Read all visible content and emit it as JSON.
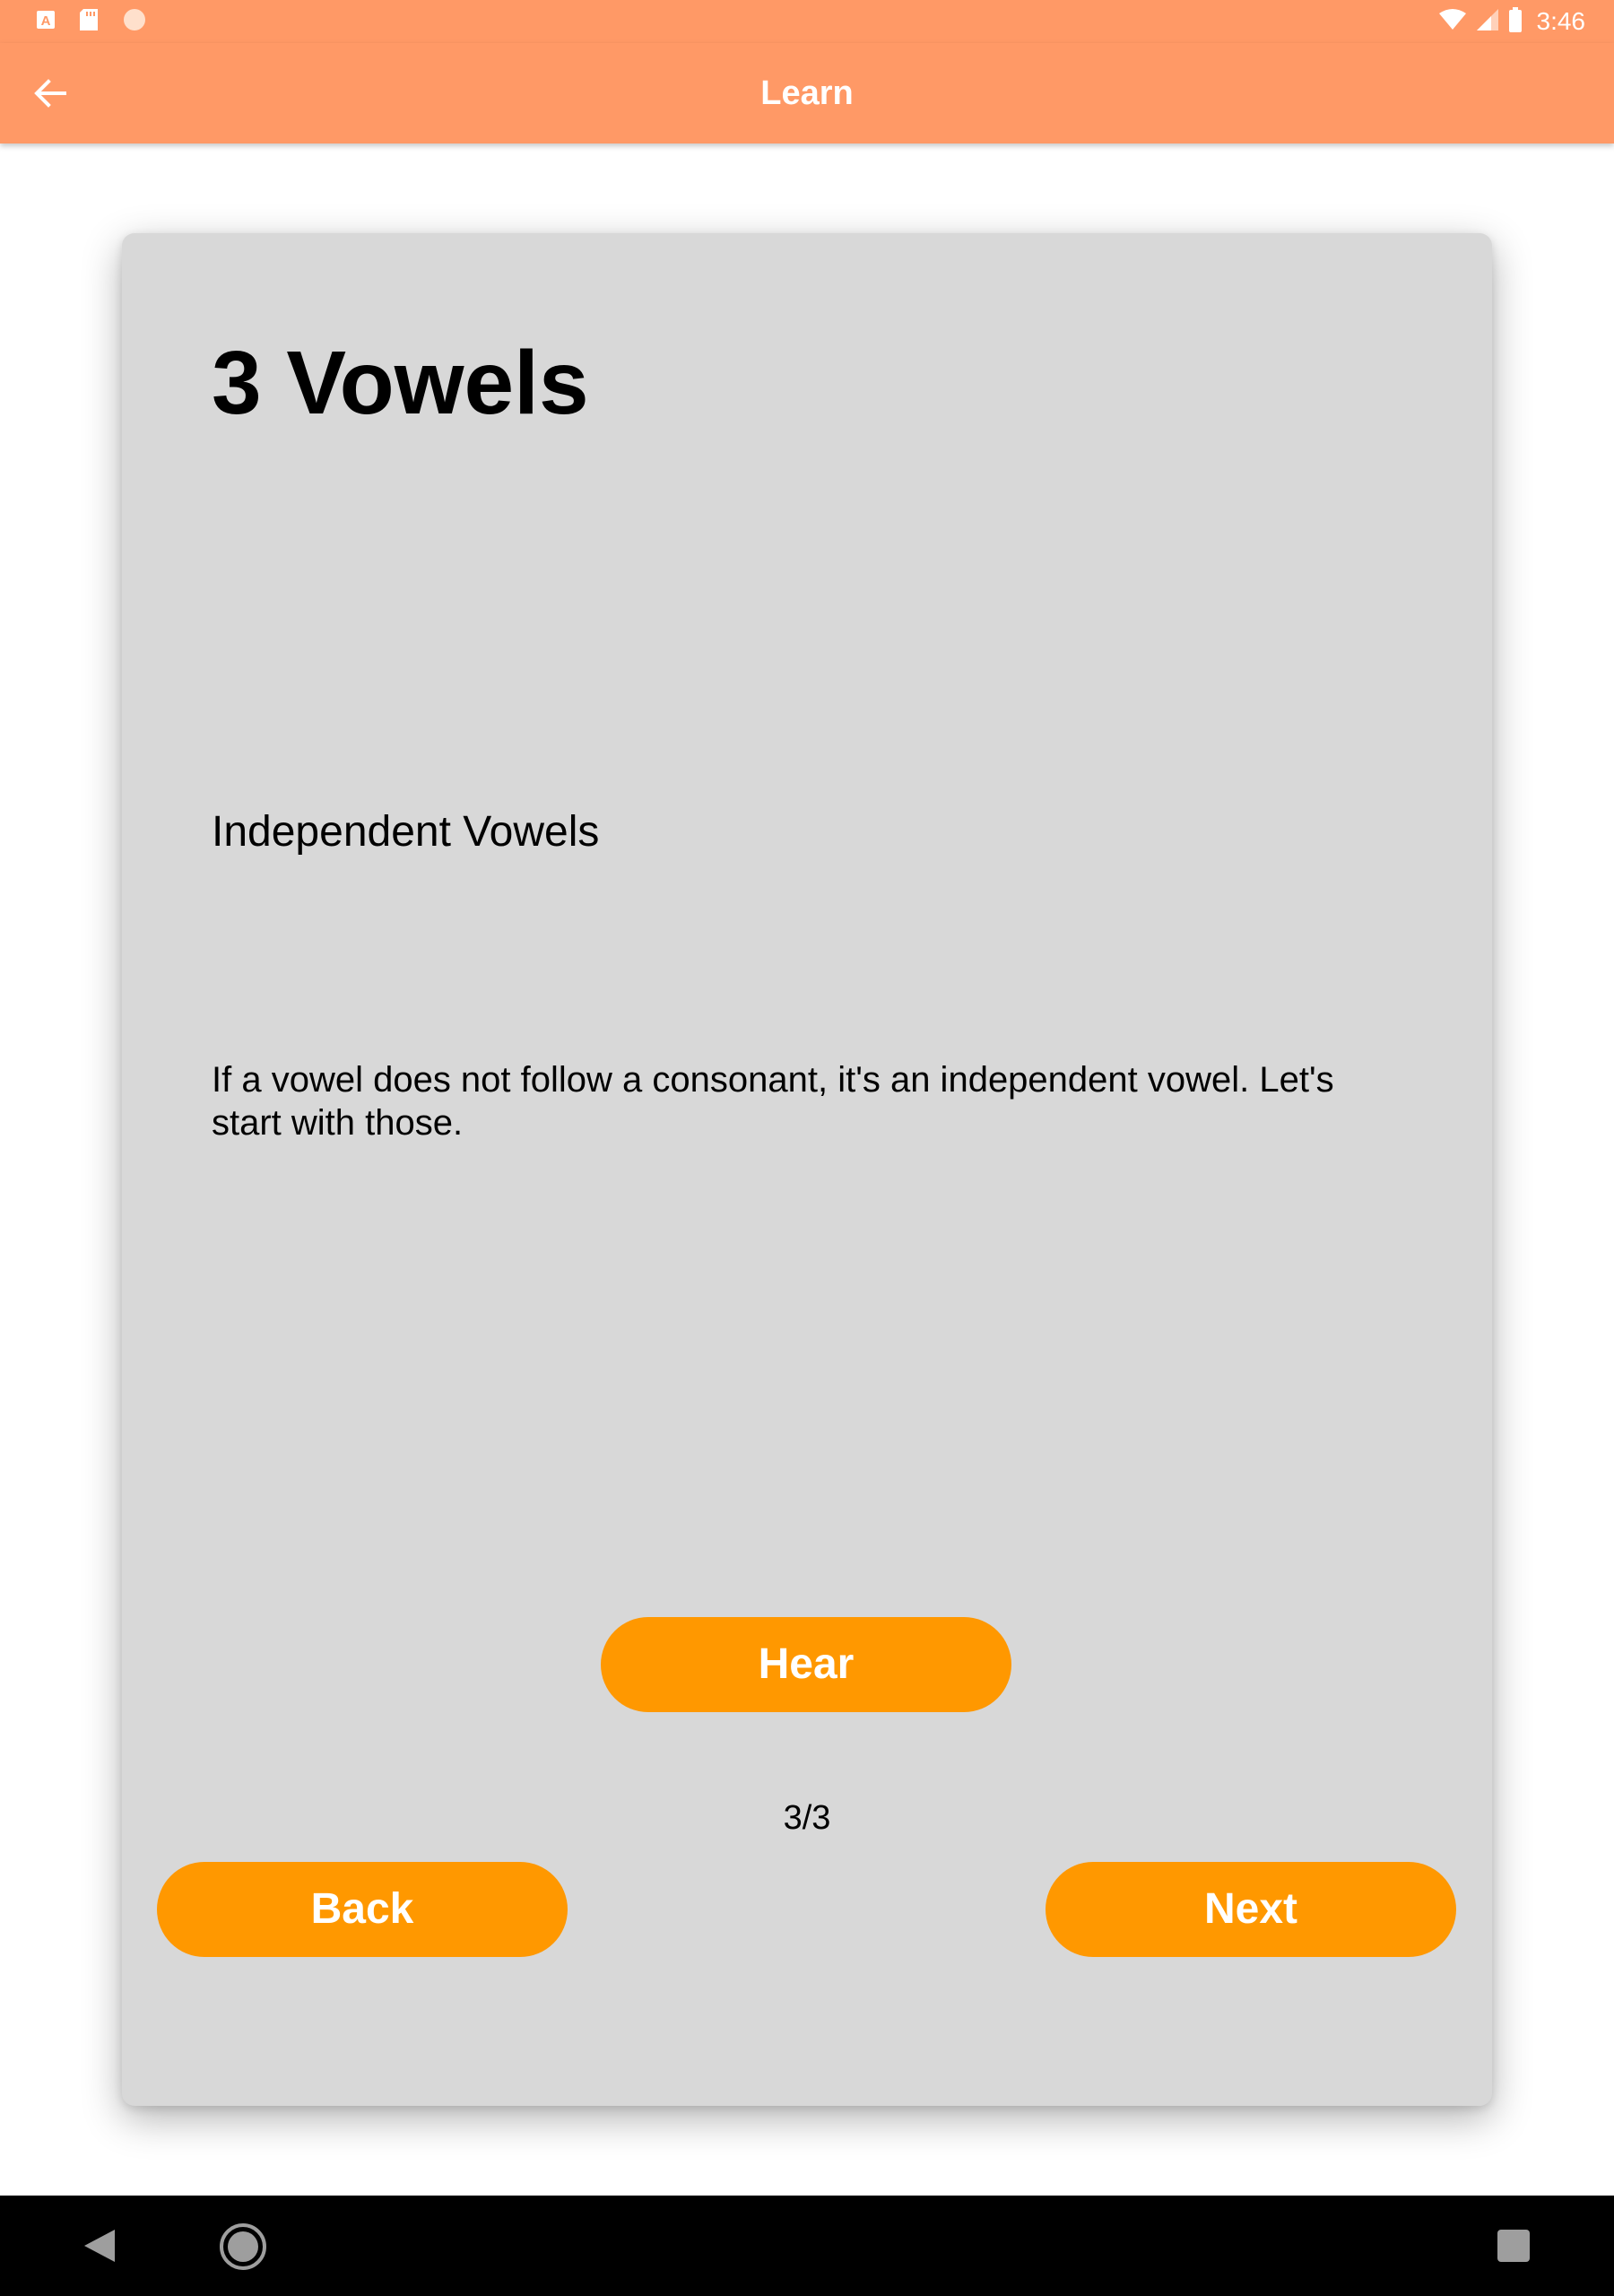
{
  "status_bar": {
    "time": "3:46",
    "left_icons": [
      "app-a-icon",
      "sd-card-icon",
      "circle-icon"
    ],
    "right_icons": [
      "wifi-icon",
      "cell-signal-icon",
      "battery-icon"
    ]
  },
  "app_bar": {
    "title": "Learn",
    "back_icon": "arrow-back-icon"
  },
  "lesson": {
    "title": "3 Vowels",
    "subtitle": "Independent Vowels",
    "body": "If a vowel does not follow a consonant, it's an independent vowel. Let's start with those.",
    "hear_label": "Hear",
    "page_indicator": "3/3",
    "back_label": "Back",
    "next_label": "Next"
  },
  "nav_bar": {
    "icons": [
      "nav-back-icon",
      "nav-home-icon",
      "nav-recents-icon"
    ]
  },
  "colors": {
    "primary": "#FF9966",
    "accent": "#FF9800",
    "card": "#D8D8D8",
    "nav_bar": "#000000",
    "text": "#000000",
    "on_primary": "#FFFFFF"
  }
}
